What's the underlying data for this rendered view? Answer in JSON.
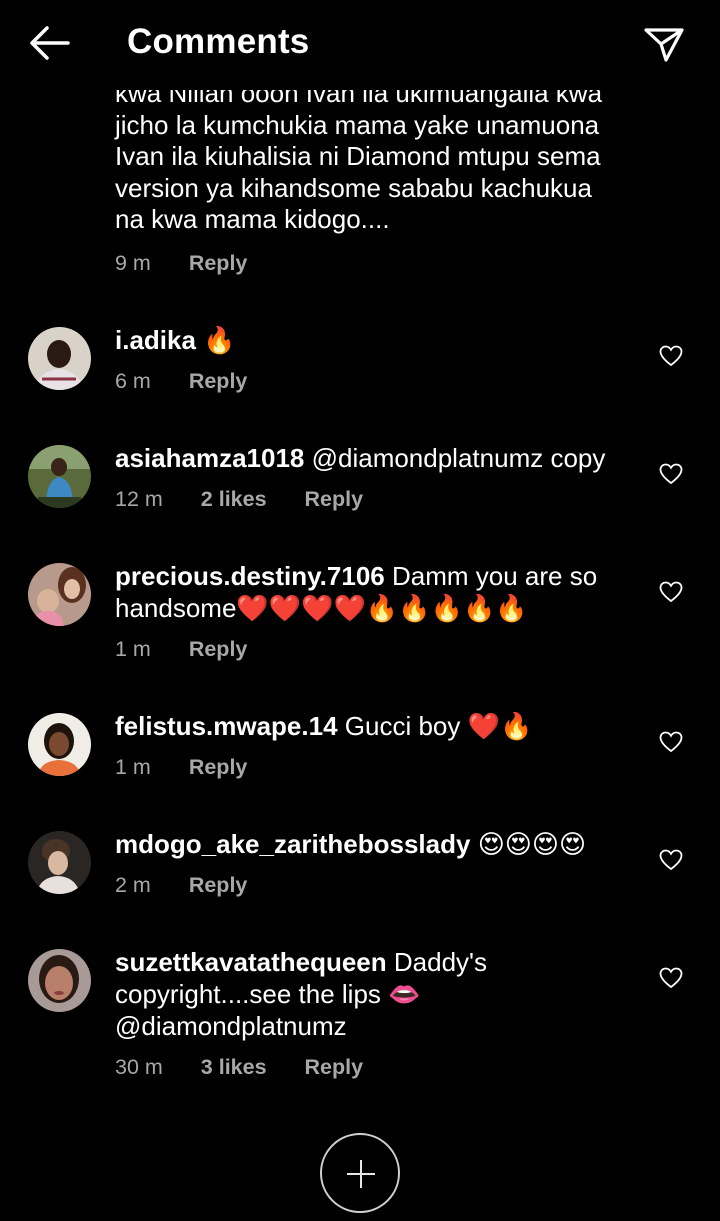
{
  "header": {
    "title": "Comments",
    "back_icon": "arrow-left-icon",
    "share_icon": "paper-plane-icon"
  },
  "truncated_comment": {
    "cut_line": "kwa Nillah oooh Ivan ila ukimuangalia kwa",
    "lines": [
      "jicho la kumchukia mama yake unamuona",
      "Ivan ila kiuhalisia ni Diamond mtupu sema",
      "version ya kihandsome sababu kachukua",
      "na kwa mama kidogo...."
    ],
    "time": "9 m",
    "reply": "Reply"
  },
  "comments": [
    {
      "username": "i.adika",
      "text": " 🔥",
      "time": "6 m",
      "likes": "",
      "reply": "Reply"
    },
    {
      "username": "asiahamza1018",
      "text": " @diamondplatnumz  copy",
      "time": "12 m",
      "likes": "2 likes",
      "reply": "Reply"
    },
    {
      "username": "precious.destiny.7106",
      "text": " Damm you are so handsome❤️❤️❤️❤️🔥🔥🔥🔥🔥",
      "time": "1 m",
      "likes": "",
      "reply": "Reply"
    },
    {
      "username": "felistus.mwape.14",
      "text": " Gucci boy ❤️🔥",
      "time": "1 m",
      "likes": "",
      "reply": "Reply"
    },
    {
      "username": "mdogo_ake_zarithebosslady",
      "text": " 😍😍😍😍",
      "time": "2 m",
      "likes": "",
      "reply": "Reply"
    },
    {
      "username": "suzettkavatathequeen",
      "text": " Daddy's copyright....see the lips 👄 @diamondplatnumz",
      "time": "30 m",
      "likes": "3 likes",
      "reply": "Reply"
    }
  ],
  "colors": {
    "background": "#000000",
    "text": "#ffffff",
    "meta": "#a8a8a8"
  }
}
